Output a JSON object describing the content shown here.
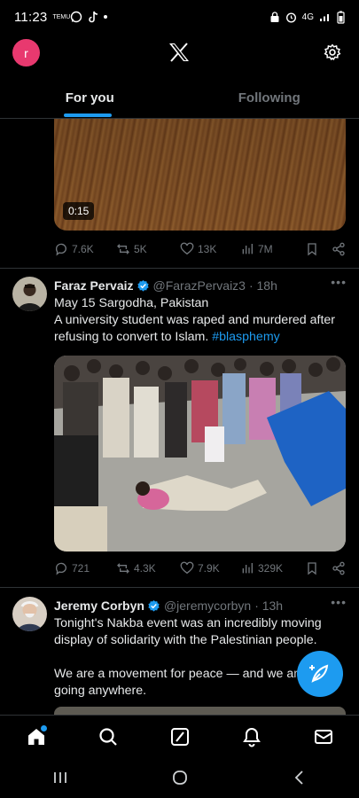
{
  "status_bar": {
    "time": "11:23",
    "app_badge": "TEMU",
    "network": "4G"
  },
  "header": {
    "avatar_letter": "r",
    "tabs": [
      {
        "label": "For you",
        "active": true
      },
      {
        "label": "Following",
        "active": false
      }
    ]
  },
  "feed": {
    "video_tweet": {
      "duration": "0:15",
      "replies": "7.6K",
      "reposts": "5K",
      "likes": "13K",
      "views": "7M"
    },
    "tweet1": {
      "name": "Faraz Pervaiz",
      "handle": "@FarazPervaiz3",
      "time": "· 18h",
      "line1": "May 15 Sargodha, Pakistan",
      "line2": "A university student was raped and murdered after refusing to convert to Islam.",
      "hashtag": "#blasphemy",
      "replies": "721",
      "reposts": "4.3K",
      "likes": "7.9K",
      "views": "329K"
    },
    "tweet2": {
      "name": "Jeremy Corbyn",
      "handle": "@jeremycorbyn",
      "time": "· 13h",
      "para1": "Tonight's Nakba event was an incredibly moving display of solidarity with the Palestinian people.",
      "para2": "We are a movement for peace — and we are not going anywhere."
    }
  },
  "colors": {
    "accent": "#1d9bf0",
    "background": "#000000",
    "muted": "#71767b",
    "avatar": "#e8396f"
  },
  "icons": {
    "fab": "compose-feather-icon",
    "nav": [
      "home-icon",
      "search-icon",
      "grok-icon",
      "notifications-icon",
      "messages-icon"
    ],
    "system": [
      "recents-icon",
      "home-circle-icon",
      "back-icon"
    ]
  }
}
